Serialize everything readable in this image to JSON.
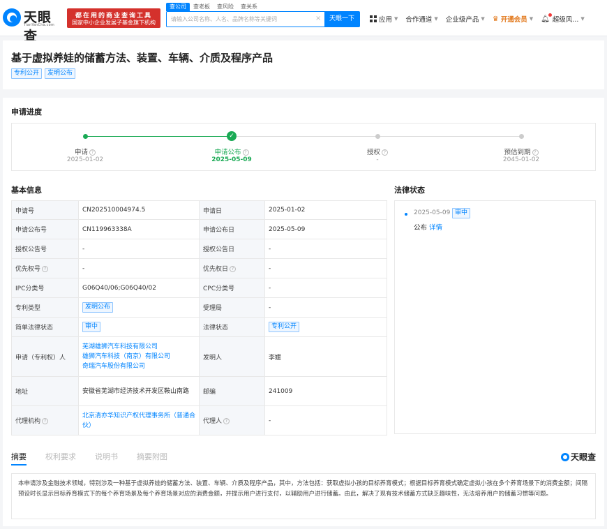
{
  "header": {
    "logo_text": "天眼查",
    "logo_sub": "TianYanCha.com",
    "promo_line1": "都在用的商业查询工具",
    "promo_line2": "国家中小企业发展子基金旗下机构",
    "search_tabs": [
      "查公司",
      "查老板",
      "查风险",
      "查关系"
    ],
    "search_placeholder": "请输入公司名称、人名、品牌名称等关键词",
    "search_button": "天眼一下",
    "nav": {
      "apps": "应用",
      "partner": "合作通道",
      "enterprise": "企业级产品",
      "vip": "开通会员",
      "user": "超级风..."
    }
  },
  "title": {
    "text": "基于虚拟养娃的储蓄方法、装置、车辆、介质及程序产品",
    "tags": [
      "专利公开",
      "发明公布"
    ]
  },
  "progress": {
    "section_title": "申请进度",
    "steps": [
      {
        "label": "申请",
        "date": "2025-01-02"
      },
      {
        "label": "申请公布",
        "date": "2025-05-09"
      },
      {
        "label": "授权",
        "date": "-"
      },
      {
        "label": "预估到期",
        "date": "2045-01-02"
      }
    ]
  },
  "basic_info": {
    "section_title": "基本信息",
    "rows": [
      {
        "k1": "申请号",
        "v1": "CN202510004974.5",
        "k2": "申请日",
        "v2": "2025-01-02"
      },
      {
        "k1": "申请公布号",
        "v1": "CN119963338A",
        "k2": "申请公布日",
        "v2": "2025-05-09"
      },
      {
        "k1": "授权公告号",
        "v1": "-",
        "k2": "授权公告日",
        "v2": "-"
      },
      {
        "k1": "优先权号",
        "v1": "-",
        "k2": "优先权日",
        "v2": "-"
      },
      {
        "k1": "IPC分类号",
        "v1": "G06Q40/06;G06Q40/02",
        "k2": "CPC分类号",
        "v2": "-"
      },
      {
        "k1": "专利类型",
        "v1": "发明公布",
        "k2": "受理局",
        "v2": "-"
      },
      {
        "k1": "简单法律状态",
        "v1": "审中",
        "k2": "法律状态",
        "v2": "专利公开"
      },
      {
        "k1": "申请（专利权）人",
        "applicants": [
          "芜湖雄狮汽车科技有限公司",
          "雄狮汽车科技（南京）有限公司",
          "奇瑞汽车股份有限公司"
        ],
        "k2": "发明人",
        "v2": "李媛"
      },
      {
        "k1": "地址",
        "v1": "安徽省芜湖市经济技术开发区鞍山南路",
        "k2": "邮编",
        "v2": "241009"
      },
      {
        "k1": "代理机构",
        "v1": "北京清亦华知识产权代理事务所（普通合伙）",
        "k2": "代理人",
        "v2": "-"
      }
    ]
  },
  "legal_status": {
    "section_title": "法律状态",
    "date": "2025-05-09",
    "tag": "审中",
    "desc": "公布",
    "detail_link": "详情"
  },
  "tabs": [
    "摘要",
    "权利要求",
    "说明书",
    "摘要附图"
  ],
  "brand": "天眼查",
  "abstract": "本申请涉及金融技术领域，特别涉及一种基于虚拟养娃的储蓄方法、装置、车辆、介质及程序产品，其中，方法包括：获取虚拟小孩的目标养育模式；根据目标养育模式确定虚拟小孩在多个养育场景下的消费金额；间隔预设时长显示目标养育模式下的每个养育场景及每个养育场景对应的消费金额，并提示用户进行支付，以辅助用户进行储蓄。由此，解决了现有技术储蓄方式缺乏趣味性，无法培养用户的储蓄习惯等问题。",
  "colors": {
    "accent": "#0084ff",
    "success": "#1aaa55",
    "promo": "#d4312c",
    "vip": "#e2781b"
  }
}
